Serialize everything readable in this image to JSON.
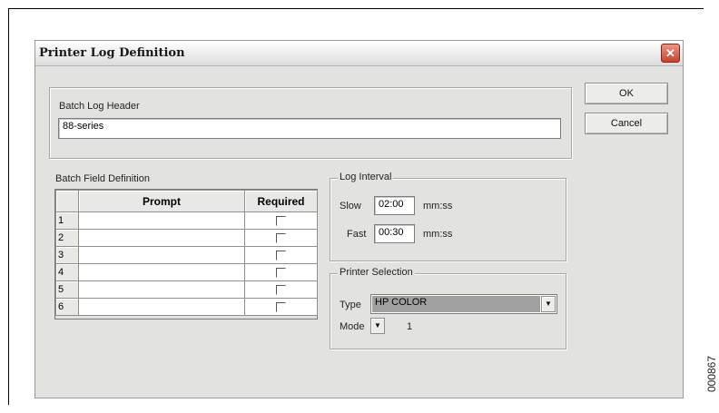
{
  "dialog": {
    "title": "Printer Log Definition",
    "close_icon": "close-icon",
    "ok_label": "OK",
    "cancel_label": "Cancel"
  },
  "batch_log_header": {
    "label": "Batch Log Header",
    "value": "88-series"
  },
  "batch_field_definition": {
    "label": "Batch Field Definition",
    "columns": [
      "Prompt",
      "Required"
    ],
    "rows": [
      {
        "number": "1",
        "prompt": "",
        "required": false
      },
      {
        "number": "2",
        "prompt": "",
        "required": false
      },
      {
        "number": "3",
        "prompt": "",
        "required": false
      },
      {
        "number": "4",
        "prompt": "",
        "required": false
      },
      {
        "number": "5",
        "prompt": "",
        "required": false
      },
      {
        "number": "6",
        "prompt": "",
        "required": false
      }
    ]
  },
  "log_interval": {
    "label": "Log Interval",
    "slow_label": "Slow",
    "slow_value": "02:00",
    "fast_label": "Fast",
    "fast_value": "00:30",
    "unit": "mm:ss"
  },
  "printer_selection": {
    "label": "Printer Selection",
    "type_label": "Type",
    "type_value": "HP COLOR",
    "mode_label": "Mode",
    "mode_value": "1"
  },
  "figure_code": "000867",
  "colors": {
    "dialog_bg": "#e2e2de",
    "close_button": "#c8442e",
    "selected_value_bg": "#a0a0a0"
  }
}
